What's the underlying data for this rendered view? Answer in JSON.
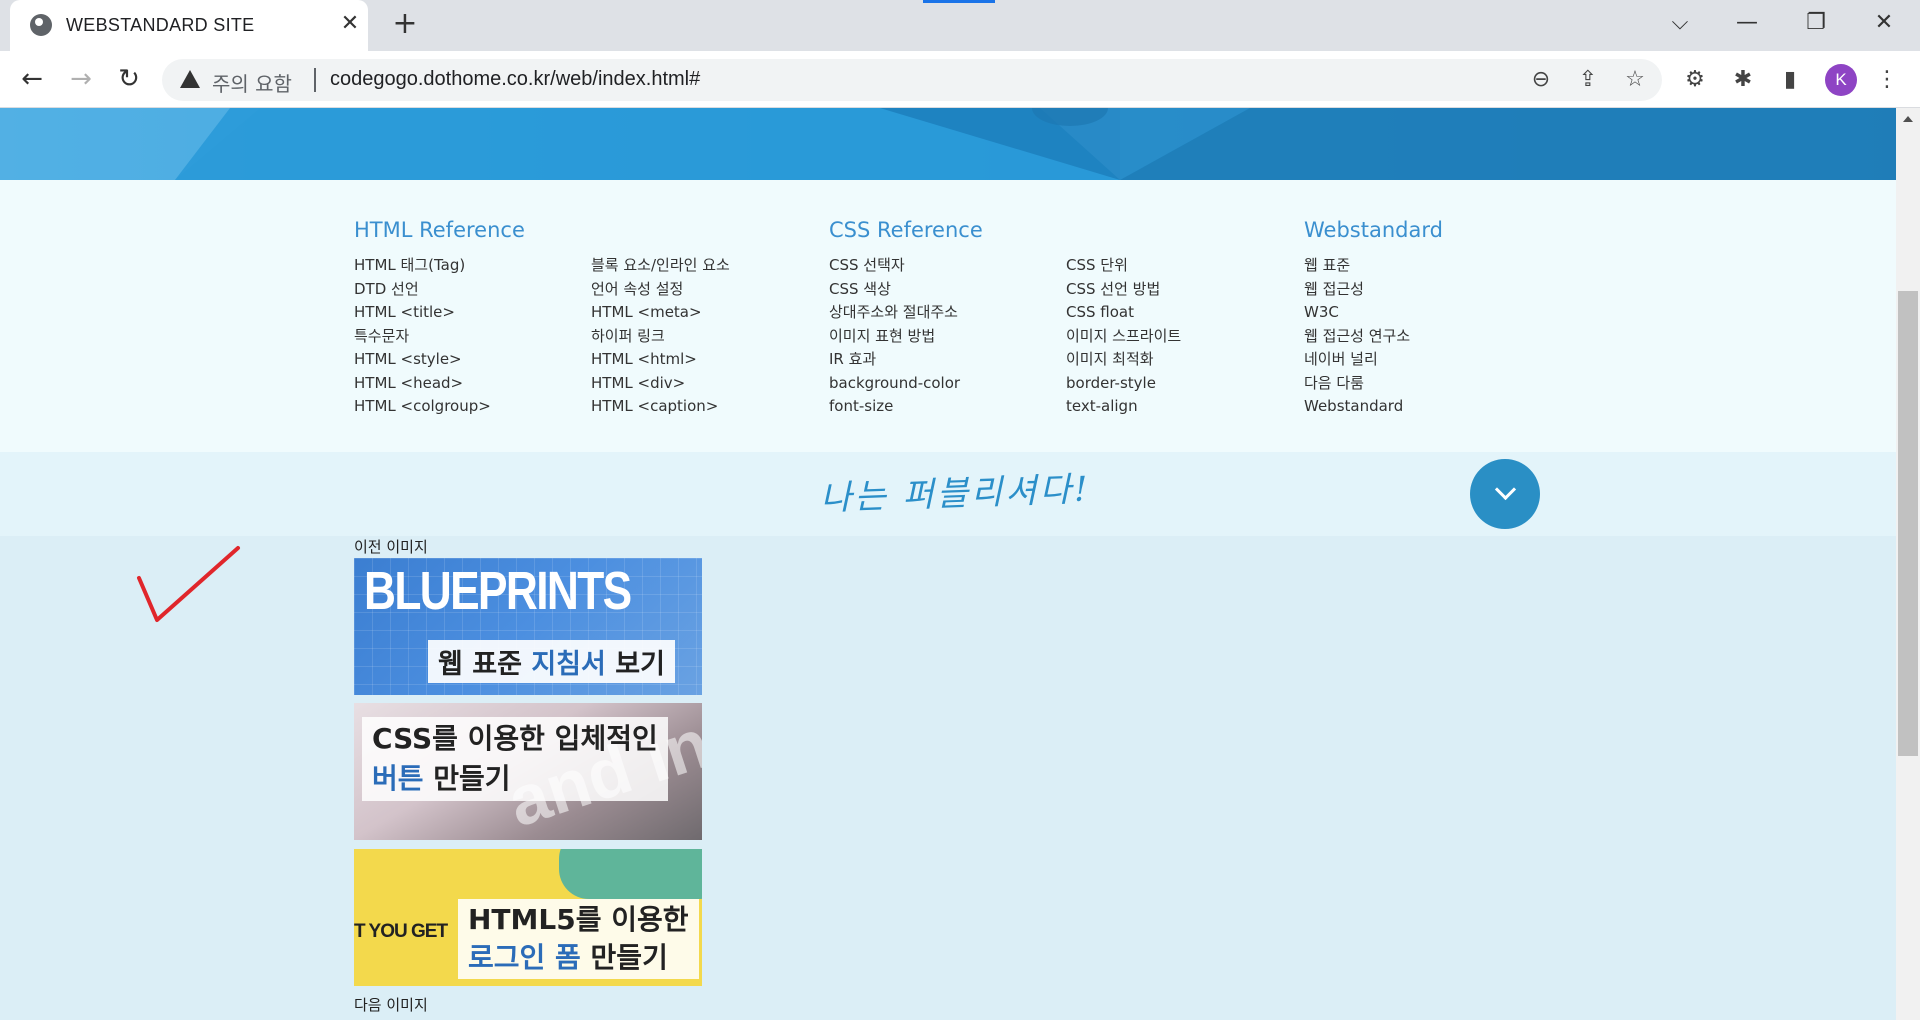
{
  "browser": {
    "tab_title": "WEBSTANDARD SITE",
    "tab_close": "✕",
    "new_tab": "+",
    "security_label": "주의 요함",
    "url": "codegogo.dothome.co.kr/web/index.html#",
    "avatar_initial": "K",
    "controls": {
      "dropdown": "⌵",
      "minimize": "—",
      "restore": "❐",
      "close": "✕"
    },
    "nav": {
      "back": "←",
      "forward": "→",
      "reload": "↻"
    },
    "icons": {
      "zoom": "⊖",
      "share": "⇪",
      "star": "☆",
      "extension1": "⚙",
      "extensions": "✱",
      "sidepanel": "▮",
      "menu": "⋮"
    }
  },
  "references": [
    {
      "title": "HTML Reference",
      "col1": [
        "HTML 태그(Tag)",
        "DTD 선언",
        "HTML <title>",
        "특수문자",
        "HTML <style>",
        "HTML <head>",
        "HTML <colgroup>"
      ],
      "col2": [
        "블록 요소/인라인 요소",
        "언어 속성 설정",
        "HTML <meta>",
        "하이퍼 링크",
        "HTML <html>",
        "HTML <div>",
        "HTML <caption>"
      ]
    },
    {
      "title": "CSS Reference",
      "col1": [
        "CSS 선택자",
        "CSS 색상",
        "상대주소와 절대주소",
        "이미지 표현 방법",
        "IR 효과",
        "background-color",
        "font-size"
      ],
      "col2": [
        "CSS 단위",
        "CSS 선언 방법",
        "CSS float",
        "이미지 스프라이트",
        "이미지 최적화",
        "border-style",
        "text-align"
      ]
    },
    {
      "title": "Webstandard",
      "col1": [
        "웹 표준",
        "웹 접근성",
        "W3C",
        "웹 접근성 연구소",
        "네이버 널리",
        "다음 다룸",
        "Webstandard"
      ]
    }
  ],
  "slogan": "나는 퍼블리셔다!",
  "slider": {
    "prev_label": "이전 이미지",
    "next_label": "다음 이미지",
    "items": [
      {
        "art_text": "BLUEPRINTS",
        "caption_a": "웹 표준 ",
        "caption_hl": "지침서",
        "caption_b": " 보기"
      },
      {
        "art_text": "and inte",
        "caption_line1": "CSS를 이용한 입체적인",
        "caption_hl": "버튼",
        "caption_b": " 만들기"
      },
      {
        "art_text": "T YOU GET",
        "caption_line1": "HTML5를 이용한",
        "caption_hl": "로그인 폼",
        "caption_b": " 만들기"
      }
    ]
  },
  "colors": {
    "accent": "#2a8fc5",
    "reference_title": "#3a8fcf",
    "check_mark": "#e0262b"
  }
}
